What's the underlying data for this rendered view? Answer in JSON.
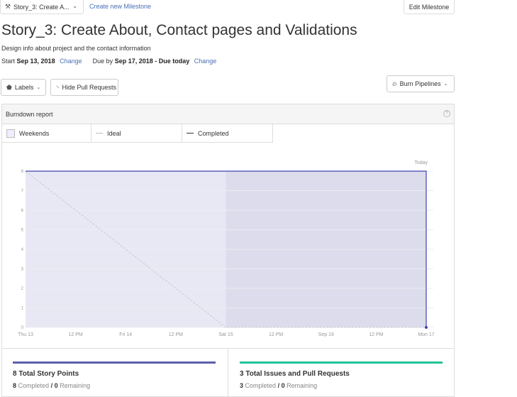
{
  "topbar": {
    "milestone_select": "Story_3: Create A...",
    "create_link": "Create new Milestone",
    "edit_button": "Edit Milestone"
  },
  "milestone": {
    "title": "Story_3: Create About, Contact pages and Validations",
    "description": "Design info about project and the contact information",
    "start_label": "Start",
    "start_date": "Sep 13, 2018",
    "due_label": "Due by",
    "due_date": "Sep 17, 2018 - Due today",
    "change_label": "Change"
  },
  "toolbar": {
    "labels_button": "Labels",
    "hide_pr_button": "Hide Pull Requests",
    "burn_button": "Burn Pipelines"
  },
  "report": {
    "title": "Burndown report",
    "help": "?",
    "legend": {
      "weekends": "Weekends",
      "ideal": "Ideal",
      "completed": "Completed"
    }
  },
  "chart_data": {
    "type": "line",
    "today_label": "Today",
    "x_ticks": [
      "Thu 13",
      "12 PM",
      "Fri 14",
      "12 PM",
      "Sat 15",
      "12 PM",
      "Sep 16",
      "12 PM",
      "Mon 17"
    ],
    "y_ticks": [
      0,
      1,
      2,
      3,
      4,
      5,
      6,
      7,
      8
    ],
    "ylim": [
      0,
      8
    ],
    "weekend_start_index": 4,
    "weekend_end_index": 8,
    "ideal_points": [
      [
        0,
        8
      ],
      [
        4,
        0
      ],
      [
        8,
        0
      ]
    ],
    "completed_points": [
      [
        0,
        8
      ],
      [
        8,
        8
      ],
      [
        8,
        0
      ]
    ],
    "colors": {
      "area": "#e8e8f5",
      "weekend": "#dcdcec",
      "completed": "#3f44b0",
      "ideal": "#c8c8d0",
      "grid": "#ececf2"
    }
  },
  "summary": {
    "story_points": {
      "title": "8 Total Story Points",
      "completed_count": "8",
      "completed_label": "Completed",
      "separator": "/",
      "remaining_count": "0",
      "remaining_label": "Remaining",
      "color": "#5d5fa8"
    },
    "issues": {
      "title": "3 Total Issues and Pull Requests",
      "completed_count": "3",
      "completed_label": "Completed",
      "separator": "/",
      "remaining_count": "0",
      "remaining_label": "Remaining",
      "color": "#22c39a"
    }
  }
}
